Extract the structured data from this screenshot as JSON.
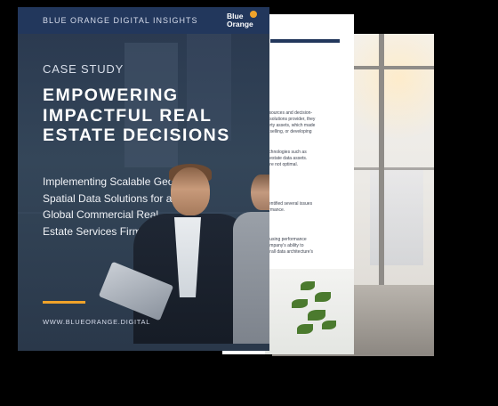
{
  "brand": {
    "header": "BLUE ORANGE DIGITAL INSIGHTS",
    "logo_line1": "Blue",
    "logo_line2": "Orange",
    "accent": "#f0a32a",
    "navy": "#22375c"
  },
  "cover": {
    "eyebrow": "CASE STUDY",
    "title": "EMPOWERING IMPACTFUL REAL ESTATE DECISIONS",
    "subtitle": "Implementing Scalable Geo-Spatial Data Solutions for a Global Commercial Real Estate Services Firm",
    "url": "WWW.BLUEORANGE.DIGITAL"
  },
  "inner_page": {
    "paragraphs": [
      "resources and decision-\nal solutions provider, they\nperty assets, which made\ng, selling, or developing",
      "technologies such as\nal estate data assets.\nvere not optimal.",
      "identified several issues\nformance.",
      "causing performance\ncompany's ability to\nverall data architecture's"
    ]
  }
}
